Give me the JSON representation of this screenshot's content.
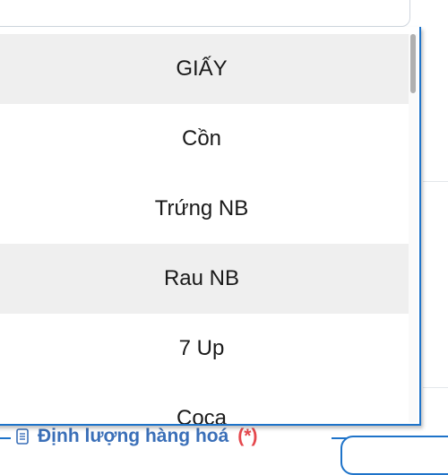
{
  "dropdown": {
    "options": [
      {
        "label": "GIẤY",
        "shaded": true
      },
      {
        "label": "Cồn",
        "shaded": false
      },
      {
        "label": "Trứng NB",
        "shaded": false
      },
      {
        "label": "Rau NB",
        "shaded": true
      },
      {
        "label": "7 Up",
        "shaded": false
      },
      {
        "label": "Coca",
        "shaded": false
      }
    ],
    "scroll_position": 0.0
  },
  "section": {
    "title": "Định lượng hàng hoá",
    "required_marker": "(*)",
    "icon": "document-icon"
  },
  "colors": {
    "accent": "#1e73c9",
    "title": "#3a6fb8",
    "required": "#e5484d",
    "option_shaded": "#efefef"
  }
}
